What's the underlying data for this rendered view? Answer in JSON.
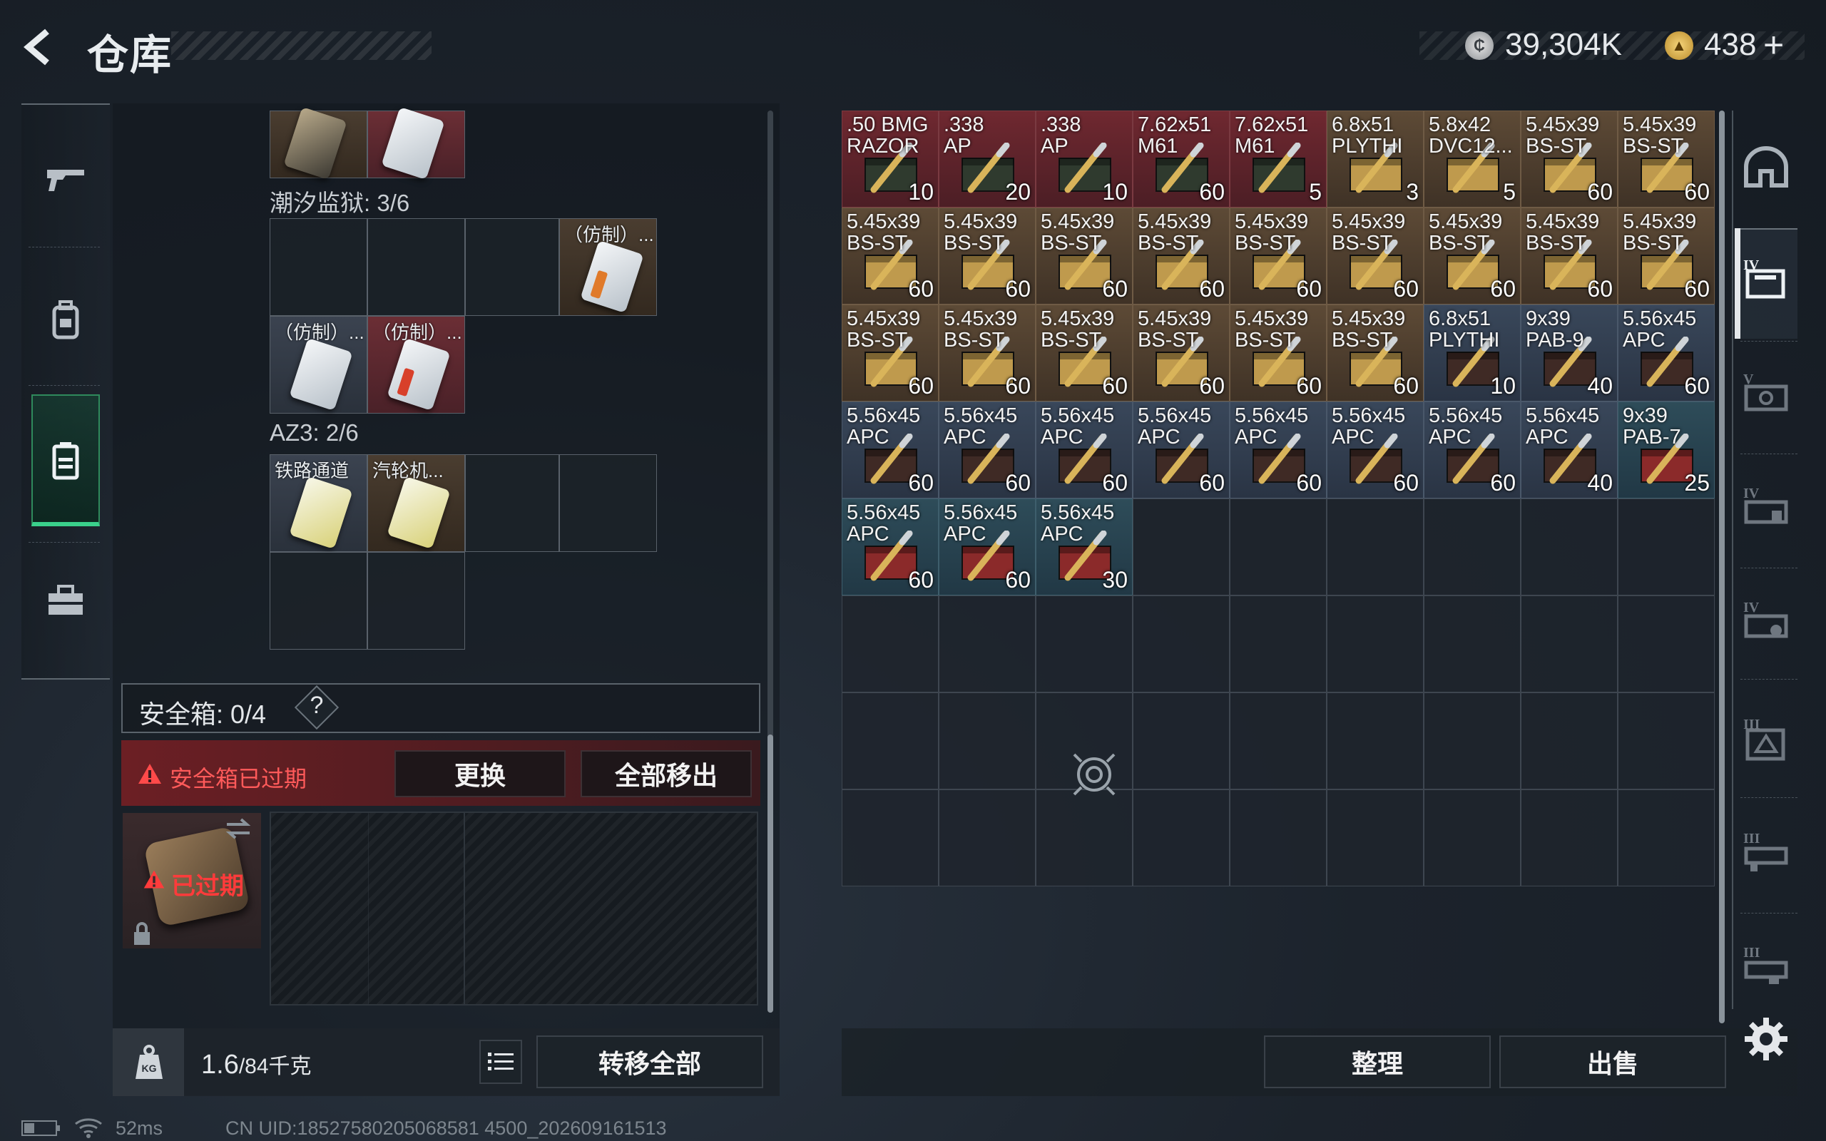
{
  "header": {
    "title": "仓库",
    "currency_silver": "39,304K",
    "currency_gold": "438",
    "plus": "+"
  },
  "left_rail": {
    "items": [
      "weapon",
      "backpack",
      "stash",
      "toolbox"
    ],
    "active": "stash"
  },
  "containers": [
    {
      "title": "潮汐监狱: 3/6"
    },
    {
      "title": "AZ3: 2/6"
    }
  ],
  "cells": {
    "fz1": "（仿制）...",
    "fz2": "（仿制）...",
    "fz3": "（仿制）...",
    "rail_tunnel": "铁路通道",
    "turbine": "汽轮机..."
  },
  "safe": {
    "label": "安全箱: 0/4",
    "help": "?",
    "warning": "安全箱已过期",
    "replace_button": "更换",
    "remove_all_button": "全部移出",
    "expired": "已过期"
  },
  "bottom_left": {
    "weight": "1.6",
    "weight_max": "/84千克",
    "transfer_all_button": "转移全部"
  },
  "bottom_right": {
    "sort_button": "整理",
    "sell_button": "出售"
  },
  "status": {
    "ping": "52ms",
    "uid": "CN UID:18527580205068581 4500_202609161513"
  },
  "stash_items": [
    {
      "name": ".50 BMG\nRAZOR",
      "count": "10",
      "color": "red"
    },
    {
      "name": ".338\nAP",
      "count": "20",
      "color": "red"
    },
    {
      "name": ".338\nAP",
      "count": "10",
      "color": "red"
    },
    {
      "name": "7.62x51\nM61",
      "count": "60",
      "color": "red"
    },
    {
      "name": "7.62x51\nM61",
      "count": "5",
      "color": "red"
    },
    {
      "name": "6.8x51\nPLYTHI",
      "count": "3",
      "color": "brown"
    },
    {
      "name": "5.8x42\nDVC12...",
      "count": "5",
      "color": "brown"
    },
    {
      "name": "5.45x39\nBS-ST",
      "count": "60",
      "color": "brown"
    },
    {
      "name": "5.45x39\nBS-ST",
      "count": "60",
      "color": "brown"
    },
    {
      "name": "5.45x39\nBS-ST",
      "count": "60",
      "color": "brown"
    },
    {
      "name": "5.45x39\nBS-ST",
      "count": "60",
      "color": "brown"
    },
    {
      "name": "5.45x39\nBS-ST",
      "count": "60",
      "color": "brown"
    },
    {
      "name": "5.45x39\nBS-ST",
      "count": "60",
      "color": "brown"
    },
    {
      "name": "5.45x39\nBS-ST",
      "count": "60",
      "color": "brown"
    },
    {
      "name": "5.45x39\nBS-ST",
      "count": "60",
      "color": "brown"
    },
    {
      "name": "5.45x39\nBS-ST",
      "count": "60",
      "color": "brown"
    },
    {
      "name": "5.45x39\nBS-ST",
      "count": "60",
      "color": "brown"
    },
    {
      "name": "5.45x39\nBS-ST",
      "count": "60",
      "color": "brown"
    },
    {
      "name": "5.45x39\nBS-ST",
      "count": "60",
      "color": "brown"
    },
    {
      "name": "5.45x39\nBS-ST",
      "count": "60",
      "color": "brown"
    },
    {
      "name": "5.45x39\nBS-ST",
      "count": "60",
      "color": "brown"
    },
    {
      "name": "5.45x39\nBS-ST",
      "count": "60",
      "color": "brown"
    },
    {
      "name": "5.45x39\nBS-ST",
      "count": "60",
      "color": "brown"
    },
    {
      "name": "5.45x39\nBS-ST",
      "count": "60",
      "color": "brown"
    },
    {
      "name": "6.8x51\nPLYTHI",
      "count": "10",
      "color": "blue"
    },
    {
      "name": "9x39\nPAB-9",
      "count": "40",
      "color": "blue"
    },
    {
      "name": "5.56x45\nAPC",
      "count": "60",
      "color": "blue"
    },
    {
      "name": "5.56x45\nAPC",
      "count": "60",
      "color": "blue"
    },
    {
      "name": "5.56x45\nAPC",
      "count": "60",
      "color": "blue"
    },
    {
      "name": "5.56x45\nAPC",
      "count": "60",
      "color": "blue"
    },
    {
      "name": "5.56x45\nAPC",
      "count": "60",
      "color": "blue"
    },
    {
      "name": "5.56x45\nAPC",
      "count": "60",
      "color": "blue"
    },
    {
      "name": "5.56x45\nAPC",
      "count": "60",
      "color": "blue"
    },
    {
      "name": "5.56x45\nAPC",
      "count": "60",
      "color": "blue"
    },
    {
      "name": "5.56x45\nAPC",
      "count": "40",
      "color": "blue"
    },
    {
      "name": "9x39\nPAB-7",
      "count": "25",
      "color": "teal"
    },
    {
      "name": "5.56x45\nAPC",
      "count": "60",
      "color": "teal"
    },
    {
      "name": "5.56x45\nAPC",
      "count": "60",
      "color": "teal"
    },
    {
      "name": "5.56x45\nAPC",
      "count": "30",
      "color": "teal"
    }
  ],
  "right_rail": {
    "items": [
      "helmet-slot",
      "case-IV",
      "case-V",
      "case-IV-b",
      "case-IV-c",
      "case-III",
      "case-III-b",
      "case-III-c"
    ],
    "active": "case-IV"
  }
}
